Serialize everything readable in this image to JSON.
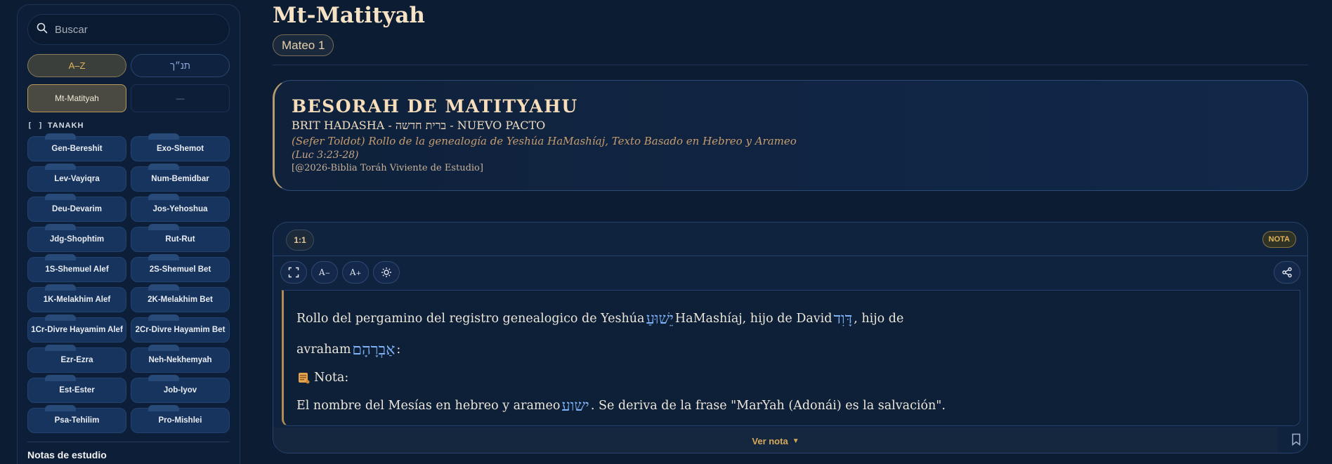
{
  "sidebar": {
    "search_placeholder": "Buscar",
    "sort_az": "A–Z",
    "sort_tanakh": "תנ״ך",
    "book_selected": "Mt-Matityah",
    "book_other": "—",
    "section_bracket": "[ ]",
    "section_title": "TANAKH",
    "books": [
      "Gen-Bereshit",
      "Exo-Shemot",
      "Lev-Vayiqra",
      "Num-Bemidbar",
      "Deu-Devarim",
      "Jos-Yehoshua",
      "Jdg-Shophtim",
      "Rut-Rut",
      "1S-Shemuel Alef",
      "2S-Shemuel Bet",
      "1K-Melakhim Alef",
      "2K-Melakhim Bet",
      "1Cr-Divre Hayamim Alef",
      "2Cr-Divre Hayamim Bet",
      "Ezr-Ezra",
      "Neh-Nekhemyah",
      "Est-Ester",
      "Job-Iyov",
      "Psa-Tehilim",
      "Pro-Mishlei"
    ],
    "notes_title": "Notas de estudio"
  },
  "main": {
    "title": "Mt-Matityah",
    "chapter": "Mateo 1",
    "header": {
      "title": "BESORAH DE MATITYAHU",
      "subtitle": "BRIT HADASHA - ברית חדשה - NUEVO PACTO",
      "description": "(Sefer Toldot) Rollo de la genealogía de Yeshúa HaMashíaj, Texto Basado en Hebreo y Arameo",
      "reference": "(Luc 3:23-28)",
      "copyright": "[@2026-Biblia Toráh Viviente de Estudio]"
    },
    "verse": {
      "number": "1:1",
      "nota_badge": "NOTA",
      "line1_a": "Rollo del pergamino del registro genealogico de Yeshúa",
      "line1_heb1": "יֵשׁוּעַ",
      "line1_b": "HaMashíaj, hijo de David",
      "line1_heb2": "דָּוִד",
      "line1_c": ", hijo de",
      "line2_a": "avraham",
      "line2_heb": "אַבְרָהָם",
      "line2_b": ":",
      "nota_label": "Nota:",
      "note_a": "El nombre del Mesías en hebreo y arameo",
      "note_heb": "ישוע",
      "note_b": ". Se deriva de la frase \"MarYah (Adonái) es la salvación\".",
      "ver_nota": "Ver nota",
      "ver_nota_arrow": "▼"
    },
    "toolbar": {
      "font_smaller": "A",
      "font_larger": "A"
    }
  },
  "colors": {
    "background": "#0c1c33",
    "accent_gold": "#e3b35a",
    "hebrew_blue": "#7eb3f7"
  }
}
